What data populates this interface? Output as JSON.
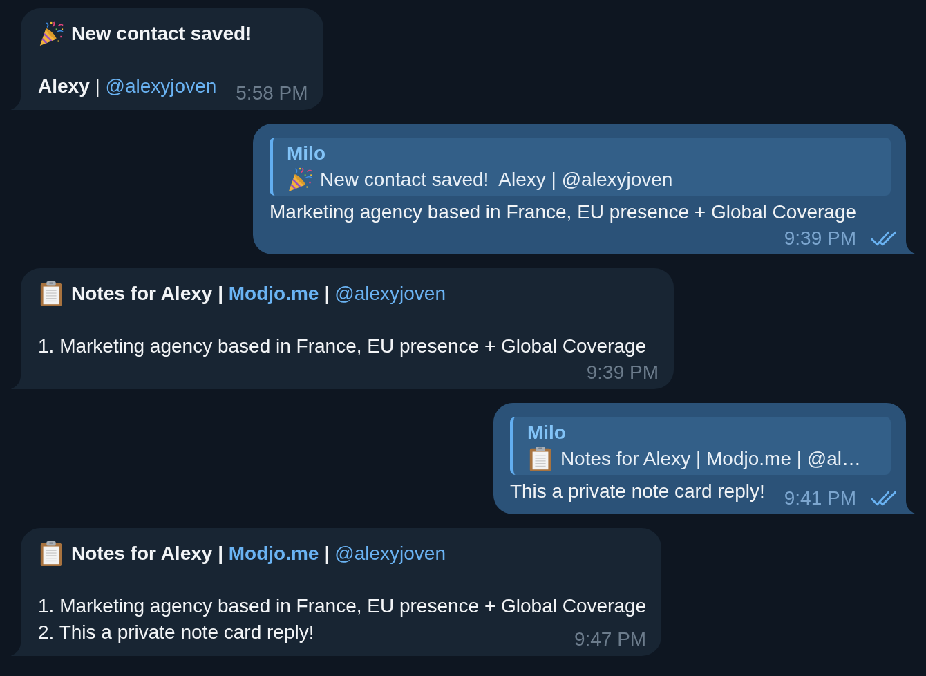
{
  "messages": [
    {
      "kind": "incoming",
      "header": {
        "kind": "contact",
        "title": [
          {
            "text": "New contact saved!",
            "bold": true,
            "link": false
          }
        ]
      },
      "lines": [
        [
          {
            "text": "Alexy",
            "bold": true,
            "link": false
          },
          {
            "text": " | ",
            "bold": false,
            "link": false
          },
          {
            "text": "@alexyjoven",
            "bold": false,
            "link": true
          }
        ]
      ],
      "time": "5:58 PM"
    },
    {
      "kind": "outgoing",
      "reply_to": {
        "sender": "Milo",
        "kind": "contact",
        "text": "New contact saved!  Alexy | @alexyjoven"
      },
      "lines": [
        [
          {
            "text": "Marketing agency based in France, EU presence + Global Coverage",
            "bold": false,
            "link": false
          }
        ]
      ],
      "time": "9:39 PM",
      "read": true
    },
    {
      "kind": "incoming",
      "header": {
        "kind": "notes",
        "title": [
          {
            "text": "Notes for Alexy | ",
            "bold": true,
            "link": false
          },
          {
            "text": "Modjo.me",
            "bold": true,
            "link": true
          },
          {
            "text": " | ",
            "bold": false,
            "link": false
          },
          {
            "text": "@alexyjoven",
            "bold": false,
            "link": true
          }
        ]
      },
      "lines": [
        [
          {
            "text": "1. Marketing agency based in France, EU presence + Global Coverage",
            "bold": false,
            "link": false
          }
        ]
      ],
      "time": "9:39 PM"
    },
    {
      "kind": "outgoing",
      "reply_to": {
        "sender": "Milo",
        "kind": "notes",
        "text": "Notes for Alexy | Modjo.me | @al…"
      },
      "lines": [
        [
          {
            "text": "This a private note card reply!",
            "bold": false,
            "link": false
          }
        ]
      ],
      "time": "9:41 PM",
      "read": true
    },
    {
      "kind": "incoming",
      "header": {
        "kind": "notes",
        "title": [
          {
            "text": "Notes for Alexy | ",
            "bold": true,
            "link": false
          },
          {
            "text": "Modjo.me",
            "bold": true,
            "link": true
          },
          {
            "text": " | ",
            "bold": false,
            "link": false
          },
          {
            "text": "@alexyjoven",
            "bold": false,
            "link": true
          }
        ]
      },
      "lines": [
        [
          {
            "text": "1. Marketing agency based in France, EU presence + Global Coverage",
            "bold": false,
            "link": false
          }
        ],
        [
          {
            "text": "2. This a private note card reply!",
            "bold": false,
            "link": false
          }
        ]
      ],
      "time": "9:47 PM"
    }
  ]
}
